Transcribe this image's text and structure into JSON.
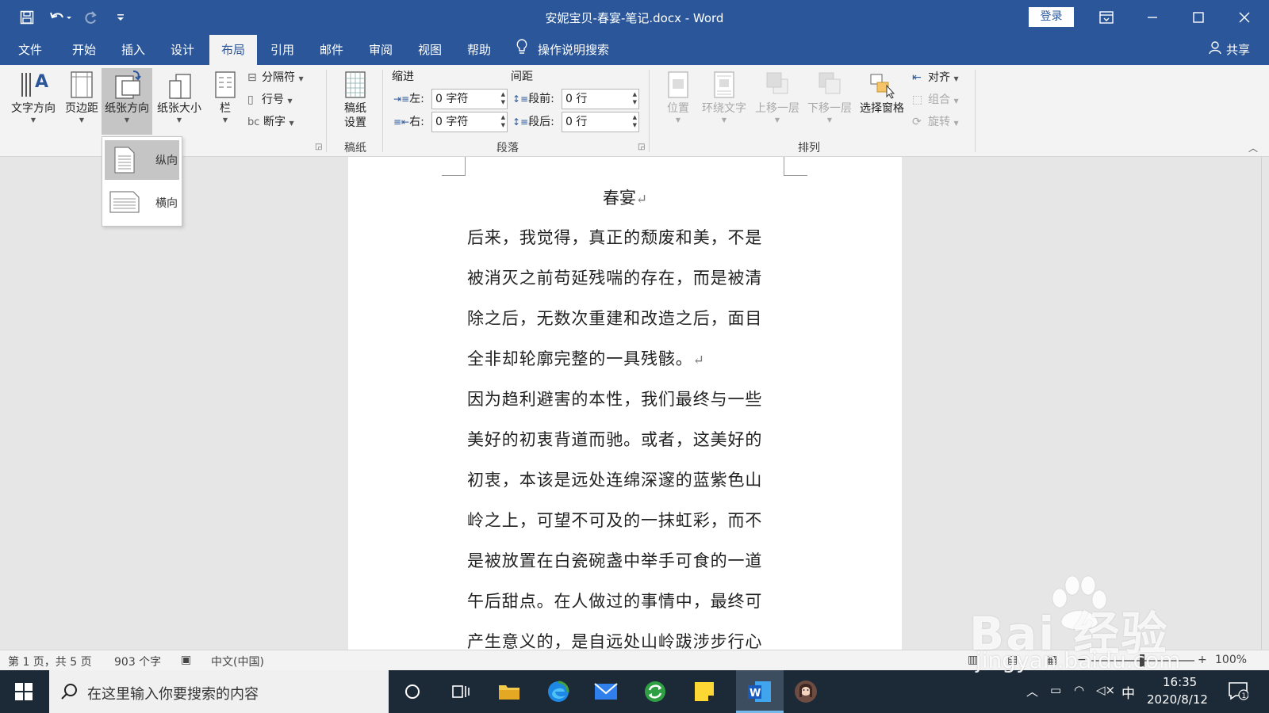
{
  "titlebar": {
    "document_title": "安妮宝贝-春宴-笔记.docx  -  Word",
    "login_label": "登录",
    "icons": [
      "save-icon",
      "undo-icon",
      "redo-icon",
      "customize-qat-icon",
      "ribbon-display-icon",
      "minimize-icon",
      "maximize-icon",
      "close-icon"
    ]
  },
  "tabs": [
    {
      "label": "文件"
    },
    {
      "label": "开始"
    },
    {
      "label": "插入"
    },
    {
      "label": "设计"
    },
    {
      "label": "布局",
      "active": true
    },
    {
      "label": "引用"
    },
    {
      "label": "邮件"
    },
    {
      "label": "审阅"
    },
    {
      "label": "视图"
    },
    {
      "label": "帮助"
    }
  ],
  "tell_me": "操作说明搜索",
  "share_label": "共享",
  "ribbon": {
    "page_setup": {
      "text_direction": "文字方向",
      "margins": "页边距",
      "orientation": "纸张方向",
      "size": "纸张大小",
      "columns": "栏",
      "breaks": "分隔符",
      "line_numbers": "行号",
      "hyphenation": "断字"
    },
    "manuscript": {
      "button": "稿纸设置",
      "button_line1": "稿纸",
      "button_line2": "设置",
      "group": "稿纸"
    },
    "paragraph": {
      "indent_title": "缩进",
      "spacing_title": "间距",
      "left_label": "左:",
      "right_label": "右:",
      "before_label": "段前:",
      "after_label": "段后:",
      "left_value": "0 字符",
      "right_value": "0 字符",
      "before_value": "0 行",
      "after_value": "0 行",
      "group": "段落"
    },
    "arrange": {
      "position": "位置",
      "wrap_text": "环绕文字",
      "bring_forward": "上移一层",
      "send_backward": "下移一层",
      "selection_pane": "选择窗格",
      "align": "对齐",
      "group_obj": "组合",
      "rotate": "旋转",
      "group": "排列"
    }
  },
  "orientation_menu": {
    "portrait": "纵向",
    "landscape": "横向",
    "selected": "纵向"
  },
  "document": {
    "heading": "春宴",
    "lines": [
      {
        "text": "后来，我觉得，真正的颓废和美，不是",
        "mark": false
      },
      {
        "text": "被消灭之前苟延残喘的存在，而是被清",
        "mark": false
      },
      {
        "text": "除之后，无数次重建和改造之后，面目",
        "mark": false
      },
      {
        "text": "全非却轮廓完整的一具残骸。",
        "mark": true
      },
      {
        "text": "因为趋利避害的本性，我们最终与一些",
        "mark": false
      },
      {
        "text": "美好的初衷背道而驰。或者，这美好的",
        "mark": false
      },
      {
        "text": "初衷，本该是远处连绵深邃的蓝紫色山",
        "mark": false
      },
      {
        "text": "岭之上，可望不可及的一抹虹彩，而不",
        "mark": false
      },
      {
        "text": "是被放置在白瓷碗盏中举手可食的一道",
        "mark": false
      },
      {
        "text": "午后甜点。在人做过的事情中，最终可",
        "mark": false
      },
      {
        "text": "产生意义的，是自远处山岭跋涉步行心",
        "mark": false
      }
    ],
    "pilcrow": "↵"
  },
  "statusbar": {
    "page": "第 1 页，共 5 页",
    "words": "903 个字",
    "language": "中文(中国)",
    "zoom": "100%"
  },
  "taskbar": {
    "search_placeholder": "在这里输入你要搜索的内容",
    "time": "16:35",
    "date": "2020/8/12",
    "ime": "中",
    "notifications": "1"
  },
  "watermark": {
    "brand": "Bai   经验",
    "url": "jingyan.baidu.com"
  },
  "colors": {
    "word_blue": "#2b579a",
    "ribbon_bg": "#f3f3f3",
    "canvas_bg": "#e6e6e6",
    "taskbar_bg": "#1c2a38"
  }
}
